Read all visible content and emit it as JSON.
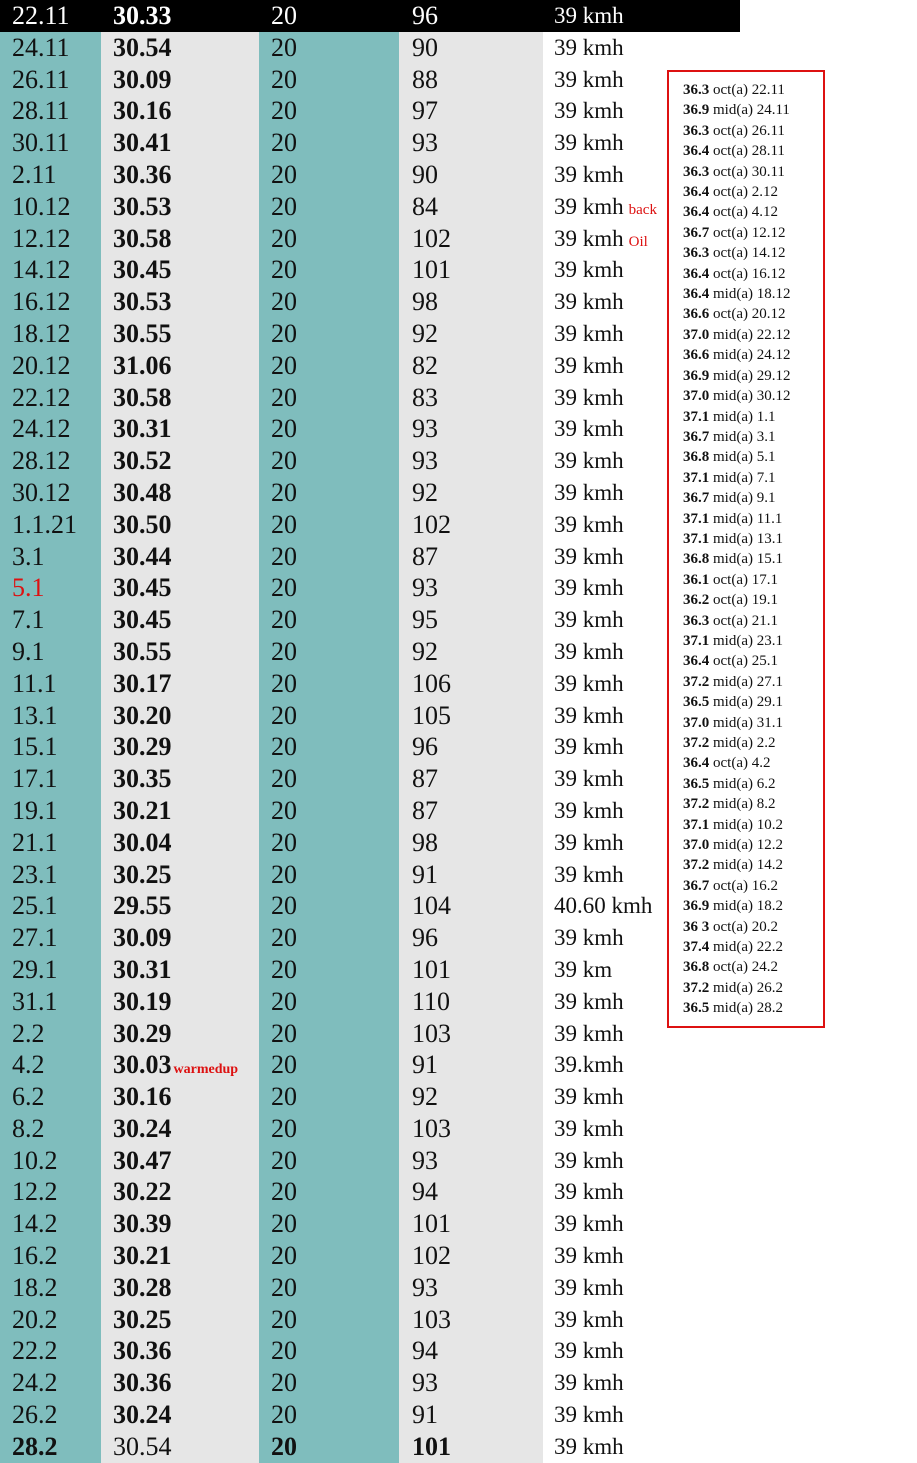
{
  "rows": [
    {
      "date": "22.11",
      "time": "30.33",
      "num": "20",
      "cal": "96",
      "speed": "39 kmh"
    },
    {
      "date": "24.11",
      "time": "30.54",
      "num": "20",
      "cal": "90",
      "speed": "39 kmh"
    },
    {
      "date": "26.11",
      "time": "30.09",
      "num": "20",
      "cal": "88",
      "speed": "39 kmh"
    },
    {
      "date": "28.11",
      "time": "30.16",
      "num": "20",
      "cal": "97",
      "speed": "39 kmh"
    },
    {
      "date": "30.11",
      "time": "30.41",
      "num": "20",
      "cal": "93",
      "speed": "39 kmh"
    },
    {
      "date": "2.11",
      "time": "30.36",
      "num": "20",
      "cal": "90",
      "speed": "39 kmh"
    },
    {
      "date": "10.12",
      "time": "30.53",
      "num": "20",
      "cal": "84",
      "speed": "39 kmh",
      "speed_note": "back"
    },
    {
      "date": "12.12",
      "time": "30.58",
      "num": "20",
      "cal": "102",
      "speed": "39 kmh",
      "speed_note": "Oil"
    },
    {
      "date": "14.12",
      "time": "30.45",
      "num": "20",
      "cal": "101",
      "speed": "39 kmh"
    },
    {
      "date": "16.12",
      "time": "30.53",
      "num": "20",
      "cal": "98",
      "speed": "39 kmh"
    },
    {
      "date": "18.12",
      "time": "30.55",
      "num": "20",
      "cal": "92",
      "speed": "39 kmh"
    },
    {
      "date": "20.12",
      "time": "31.06",
      "num": "20",
      "cal": "82",
      "speed": "39 kmh"
    },
    {
      "date": "22.12",
      "time": "30.58",
      "num": "20",
      "cal": "83",
      "speed": "39 kmh"
    },
    {
      "date": "24.12",
      "time": "30.31",
      "num": "20",
      "cal": "93",
      "speed": "39 kmh"
    },
    {
      "date": "28.12",
      "time": "30.52",
      "num": "20",
      "cal": "93",
      "speed": "39 kmh"
    },
    {
      "date": "30.12",
      "time": "30.48",
      "num": "20",
      "cal": "92",
      "speed": "39 kmh"
    },
    {
      "date": "1.1.21",
      "time": "30.50",
      "num": "20",
      "cal": "102",
      "speed": "39 kmh"
    },
    {
      "date": "3.1",
      "time": "30.44",
      "num": "20",
      "cal": "87",
      "speed": "39 kmh"
    },
    {
      "date": "5.1",
      "time": "30.45",
      "num": "20",
      "cal": "93",
      "speed": "39 kmh",
      "date_red": true
    },
    {
      "date": "7.1",
      "time": "30.45",
      "num": "20",
      "cal": "95",
      "speed": "39 kmh"
    },
    {
      "date": "9.1",
      "time": "30.55",
      "num": "20",
      "cal": "92",
      "speed": "39 kmh"
    },
    {
      "date": "11.1",
      "time": "30.17",
      "num": "20",
      "cal": "106",
      "speed": "39 kmh"
    },
    {
      "date": "13.1",
      "time": "30.20",
      "num": "20",
      "cal": "105",
      "speed": "39 kmh"
    },
    {
      "date": "15.1",
      "time": "30.29",
      "num": "20",
      "cal": "96",
      "speed": "39 kmh"
    },
    {
      "date": "17.1",
      "time": "30.35",
      "num": "20",
      "cal": "87",
      "speed": "39 kmh"
    },
    {
      "date": "19.1",
      "time": "30.21",
      "num": "20",
      "cal": "87",
      "speed": "39 kmh"
    },
    {
      "date": "21.1",
      "time": "30.04",
      "num": "20",
      "cal": "98",
      "speed": "39 kmh"
    },
    {
      "date": "23.1",
      "time": "30.25",
      "num": "20",
      "cal": "91",
      "speed": "39 kmh"
    },
    {
      "date": "25.1",
      "time": "29.55",
      "num": "20",
      "cal": "104",
      "speed": "40.60 kmh"
    },
    {
      "date": "27.1",
      "time": "30.09",
      "num": "20",
      "cal": "96",
      "speed": "39 kmh"
    },
    {
      "date": "29.1",
      "time": "30.31",
      "num": "20",
      "cal": "101",
      "speed": "39 km"
    },
    {
      "date": "31.1",
      "time": "30.19",
      "num": "20",
      "cal": "110",
      "speed": "39 kmh"
    },
    {
      "date": "2.2",
      "time": "30.29",
      "num": "20",
      "cal": "103",
      "speed": "39 kmh"
    },
    {
      "date": "4.2",
      "time": "30.03",
      "num": "20",
      "cal": "91",
      "speed": "39.kmh",
      "time_note": "warmedup"
    },
    {
      "date": "6.2",
      "time": "30.16",
      "num": "20",
      "cal": "92",
      "speed": "39 kmh"
    },
    {
      "date": "8.2",
      "time": "30.24",
      "num": "20",
      "cal": "103",
      "speed": "39 kmh"
    },
    {
      "date": "10.2",
      "time": "30.47",
      "num": "20",
      "cal": "93",
      "speed": "39 kmh"
    },
    {
      "date": "12.2",
      "time": "30.22",
      "num": "20",
      "cal": "94",
      "speed": "39 kmh"
    },
    {
      "date": "14.2",
      "time": "30.39",
      "num": "20",
      "cal": "101",
      "speed": "39 kmh"
    },
    {
      "date": "16.2",
      "time": "30.21",
      "num": "20",
      "cal": "102",
      "speed": "39 kmh"
    },
    {
      "date": "18.2",
      "time": "30.28",
      "num": "20",
      "cal": "93",
      "speed": "39 kmh"
    },
    {
      "date": "20.2",
      "time": "30.25",
      "num": "20",
      "cal": "103",
      "speed": "39 kmh"
    },
    {
      "date": "22.2",
      "time": "30.36",
      "num": "20",
      "cal": "94",
      "speed": "39 kmh"
    },
    {
      "date": "24.2",
      "time": "30.36",
      "num": "20",
      "cal": "93",
      "speed": "39 kmh"
    },
    {
      "date": "26.2",
      "time": "30.24",
      "num": "20",
      "cal": "91",
      "speed": "39 kmh"
    },
    {
      "date": "28.2",
      "time": "30.54",
      "num": "20",
      "cal": "101",
      "speed": "39 kmh",
      "last": true
    }
  ],
  "temperatures": [
    {
      "value": "36.3",
      "label": "oct(a) 22.11"
    },
    {
      "value": "36.9",
      "label": "mid(a) 24.11"
    },
    {
      "value": "36.3",
      "label": "oct(a) 26.11"
    },
    {
      "value": "36.4",
      "label": "oct(a) 28.11"
    },
    {
      "value": "36.3",
      "label": "oct(a) 30.11"
    },
    {
      "value": "36.4",
      "label": "oct(a) 2.12"
    },
    {
      "value": "36.4",
      "label": "oct(a) 4.12"
    },
    {
      "value": "36.7",
      "label": "oct(a) 12.12"
    },
    {
      "value": "36.3",
      "label": "oct(a) 14.12"
    },
    {
      "value": "36.4",
      "label": "oct(a) 16.12"
    },
    {
      "value": "36.4",
      "label": "mid(a) 18.12"
    },
    {
      "value": "36.6",
      "label": "oct(a) 20.12"
    },
    {
      "value": "37.0",
      "label": "mid(a) 22.12"
    },
    {
      "value": "36.6",
      "label": "mid(a) 24.12"
    },
    {
      "value": "36.9",
      "label": "mid(a) 29.12"
    },
    {
      "value": "37.0",
      "label": "mid(a) 30.12"
    },
    {
      "value": "37.1",
      "label": "mid(a) 1.1"
    },
    {
      "value": "36.7",
      "label": "mid(a) 3.1"
    },
    {
      "value": "36.8",
      "label": "mid(a) 5.1"
    },
    {
      "value": "37.1",
      "label": "mid(a) 7.1"
    },
    {
      "value": "36.7",
      "label": "mid(a) 9.1"
    },
    {
      "value": "37.1",
      "label": "mid(a) 11.1"
    },
    {
      "value": "37.1",
      "label": "mid(a) 13.1"
    },
    {
      "value": "36.8",
      "label": "mid(a) 15.1"
    },
    {
      "value": "36.1",
      "label": "oct(a) 17.1"
    },
    {
      "value": "36.2",
      "label": "oct(a) 19.1"
    },
    {
      "value": "36.3",
      "label": "oct(a) 21.1"
    },
    {
      "value": "37.1",
      "label": "mid(a) 23.1"
    },
    {
      "value": "36.4",
      "label": "oct(a) 25.1"
    },
    {
      "value": "37.2",
      "label": "mid(a) 27.1"
    },
    {
      "value": "36.5",
      "label": "mid(a) 29.1"
    },
    {
      "value": "37.0",
      "label": "mid(a) 31.1"
    },
    {
      "value": "37.2",
      "label": "mid(a) 2.2"
    },
    {
      "value": "36.4",
      "label": "oct(a) 4.2"
    },
    {
      "value": "36.5",
      "label": "mid(a) 6.2"
    },
    {
      "value": "37.2",
      "label": "mid(a) 8.2"
    },
    {
      "value": "37.1",
      "label": "mid(a) 10.2"
    },
    {
      "value": "37.0",
      "label": "mid(a) 12.2"
    },
    {
      "value": "37.2",
      "label": "mid(a) 14.2"
    },
    {
      "value": "36.7",
      "label": "oct(a) 16.2"
    },
    {
      "value": "36.9",
      "label": "mid(a) 18.2"
    },
    {
      "value": "36 3",
      "label": "oct(a) 20.2"
    },
    {
      "value": "37.4",
      "label": "mid(a) 22.2"
    },
    {
      "value": "36.8",
      "label": "oct(a) 24.2"
    },
    {
      "value": "37.2",
      "label": "mid(a) 26.2"
    },
    {
      "value": "36.5",
      "label": "mid(a) 28.2"
    }
  ],
  "colors": {
    "teal": "#7fbdbd",
    "light_gray": "#e6e6e6",
    "note_red": "#dd1111",
    "header_black": "#000000"
  }
}
